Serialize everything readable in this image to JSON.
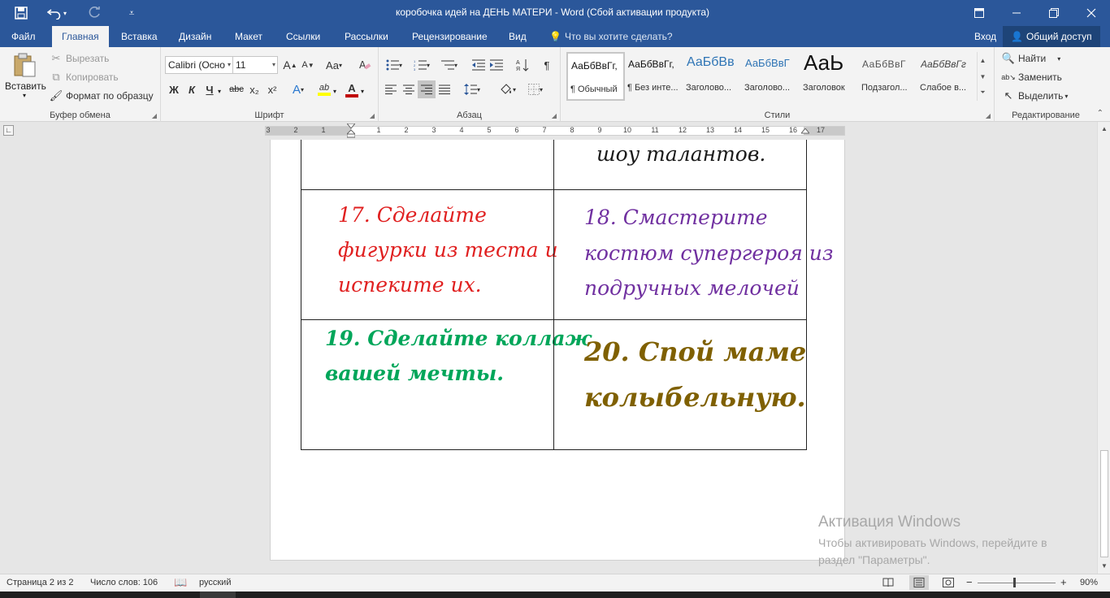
{
  "titlebar": {
    "title": "коробочка идей на ДЕНЬ МАТЕРИ - Word (Сбой активации продукта)",
    "icons": [
      "save-icon",
      "undo-icon",
      "redo-icon",
      "customize-qat-icon",
      "ribbon-display-icon",
      "minimize-icon",
      "restore-icon",
      "close-icon"
    ]
  },
  "tabs": {
    "items": [
      "Файл",
      "Главная",
      "Вставка",
      "Дизайн",
      "Макет",
      "Ссылки",
      "Рассылки",
      "Рецензирование",
      "Вид"
    ],
    "active": "Главная",
    "tell_me": "Что вы хотите сделать?",
    "signin": "Вход",
    "share": "Общий доступ"
  },
  "ribbon": {
    "clipboard": {
      "label": "Буфер обмена",
      "paste": "Вставить",
      "cut": "Вырезать",
      "copy": "Копировать",
      "format_painter": "Формат по образцу"
    },
    "font": {
      "label": "Шрифт",
      "font_name": "Calibri (Осно",
      "font_size": "11",
      "grow": "A",
      "shrink": "A",
      "case": "Aa",
      "bold": "Ж",
      "italic": "К",
      "underline": "Ч",
      "strike": "abc",
      "subscript": "x₂",
      "superscript": "x²",
      "effects": "A",
      "highlight": "ab",
      "color": "A",
      "highlight_color": "#ffff00",
      "font_color": "#c00000"
    },
    "paragraph": {
      "label": "Абзац",
      "pilcrow": "¶"
    },
    "styles": {
      "label": "Стили",
      "items": [
        {
          "preview": "АаБбВвГг,",
          "name": "¶ Обычный"
        },
        {
          "preview": "АаБбВвГг,",
          "name": "¶ Без инте..."
        },
        {
          "preview": "АаБбВв",
          "name": "Заголово..."
        },
        {
          "preview": "АаБбВвГ",
          "name": "Заголово..."
        },
        {
          "preview": "АаЬ",
          "name": "Заголовок"
        },
        {
          "preview": "АаБбВвГ",
          "name": "Подзагол..."
        },
        {
          "preview": "АаБбВвГг",
          "name": "Слабое в..."
        }
      ],
      "heading_color": "#2e74b5"
    },
    "editing": {
      "label": "Редактирование",
      "find": "Найти",
      "replace": "Заменить",
      "select": "Выделить"
    }
  },
  "ruler": {
    "numbers": [
      "3",
      "2",
      "1",
      "1",
      "2",
      "3",
      "4",
      "5",
      "6",
      "7",
      "8",
      "9",
      "10",
      "11",
      "12",
      "13",
      "14",
      "15",
      "16",
      "17"
    ]
  },
  "document": {
    "cells": {
      "c16": "шоу талантов.",
      "c17_line1": "17.  Сделайте",
      "c17_line2": "фигурки из теста и",
      "c17_line3": "испеките их.",
      "c18_line1": "18. Смастерите",
      "c18_line2": "костюм супергероя из",
      "c18_line3": "подручных мелочей",
      "c19_line1": "19. Сделайте коллаж",
      "c19_line2": "вашей мечты.",
      "c20_line1": "20. Спой маме",
      "c20_line2": "колыбельную."
    },
    "colors": {
      "black": "#1a1a1a",
      "red": "#e02020",
      "purple": "#7030a0",
      "green": "#00a65a",
      "olive": "#7f6000"
    }
  },
  "watermark": {
    "title": "Активация Windows",
    "line1": "Чтобы активировать Windows, перейдите в",
    "line2": "раздел \"Параметры\"."
  },
  "statusbar": {
    "page": "Страница 2 из 2",
    "words": "Число слов: 106",
    "language": "русский",
    "zoom": "90%",
    "zoom_minus": "−",
    "zoom_plus": "+"
  }
}
